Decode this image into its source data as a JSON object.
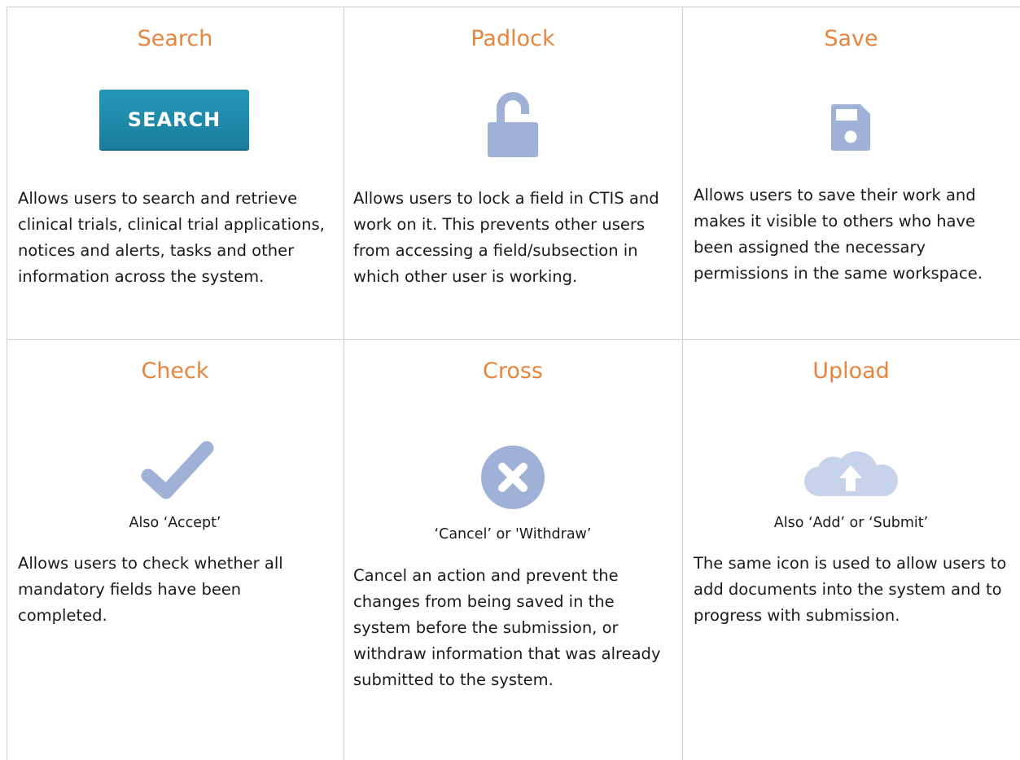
{
  "cells": {
    "search": {
      "title": "Search",
      "button_label": "SEARCH",
      "description": "Allows users to search and retrieve clinical trials, clinical trial applications, notices and alerts, tasks and other information across the system."
    },
    "padlock": {
      "title": "Padlock",
      "description": "Allows users to lock a field in CTIS and work on it. This prevents other users from accessing a field/subsection in which other user is working."
    },
    "save": {
      "title": "Save",
      "description": "Allows users to save their work and makes it visible to others who have been assigned the necessary permissions in the same workspace."
    },
    "check": {
      "title": "Check",
      "subtitle": "Also ‘Accept’",
      "description": "Allows users to check whether all mandatory fields have been completed."
    },
    "cross": {
      "title": "Cross",
      "subtitle": "‘Cancel’ or 'Withdraw’",
      "description": "Cancel an action and prevent the changes from being saved in the system before the submission, or withdraw information that was already submitted to the system."
    },
    "upload": {
      "title": "Upload",
      "subtitle": "Also ‘Add’ or ‘Submit’",
      "description": "The same icon is used to allow users to add documents into the system and to progress with submission."
    }
  },
  "colors": {
    "title": "#e8853d",
    "icon": "#9fb1d6",
    "search_button": "#1f8aab",
    "grid_line": "#cfcfcf"
  },
  "icons": {
    "padlock": "padlock-open-icon",
    "save": "floppy-disk-icon",
    "check": "checkmark-icon",
    "cross": "cross-circle-icon",
    "upload": "cloud-upload-icon"
  }
}
